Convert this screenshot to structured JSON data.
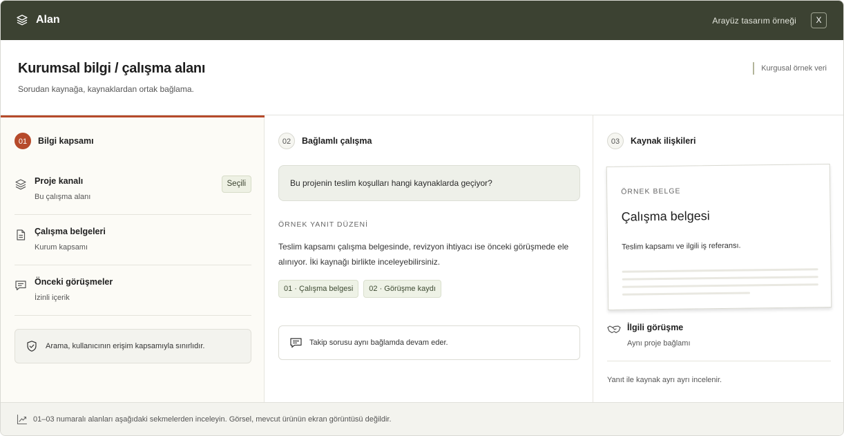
{
  "app": {
    "title": "Alan",
    "caption": "Arayüz tasarım örneği",
    "close_label": "X",
    "logo_icon": "layers-icon"
  },
  "header": {
    "title": "Kurumsal bilgi / çalışma alanı",
    "subtitle": "Sorudan kaynağa, kaynaklardan ortak bağlama.",
    "note": "Kurgusal örnek veri"
  },
  "colors": {
    "topbar": "#3c4232",
    "accent": "#b64a2b",
    "chip_bg": "#eef2e6"
  },
  "column1": {
    "step_number": "01",
    "step_label": "Bilgi kapsamı",
    "items": [
      {
        "title": "Proje kanalı",
        "subtitle": "Bu çalışma alanı",
        "badge": "Seçili",
        "icon": "layers-icon"
      },
      {
        "title": "Çalışma belgeleri",
        "subtitle": "Kurum kapsamı",
        "icon": "document-icon"
      },
      {
        "title": "Önceki görüşmeler",
        "subtitle": "İzinli içerik",
        "icon": "chat-icon"
      }
    ],
    "notice": "Arama, kullanıcının erişim kapsamıyla sınırlıdır."
  },
  "column2": {
    "step_number": "02",
    "step_label": "Bağlamlı çalışma",
    "question": "Bu projenin teslim koşulları hangi kaynaklarda geçiyor?",
    "answer_label": "ÖRNEK YANIT DÜZENİ",
    "answer": "Teslim kapsamı çalışma belgesinde, revizyon ihtiyacı ise önceki görüşmede ele alınıyor. İki kaynağı birlikte inceleyebilirsiniz.",
    "chips": [
      "01 · Çalışma belgesi",
      "02 · Görüşme kaydı"
    ],
    "followup": "Takip sorusu aynı bağlamda devam eder."
  },
  "column3": {
    "step_number": "03",
    "step_label": "Kaynak ilişkileri",
    "doc": {
      "kicker": "ÖRNEK BELGE",
      "title": "Çalışma belgesi",
      "description": "Teslim kapsamı ve ilgili iş referansı."
    },
    "related": {
      "title": "İlgili görüşme",
      "subtitle": "Aynı proje bağlamı",
      "icon": "handshake-icon"
    },
    "footnote": "Yanıt ile kaynak ayrı ayrı incelenir."
  },
  "footer": {
    "text": "01–03 numaralı alanları aşağıdaki sekmelerden inceleyin. Görsel, mevcut ürünün ekran görüntüsü değildir."
  }
}
